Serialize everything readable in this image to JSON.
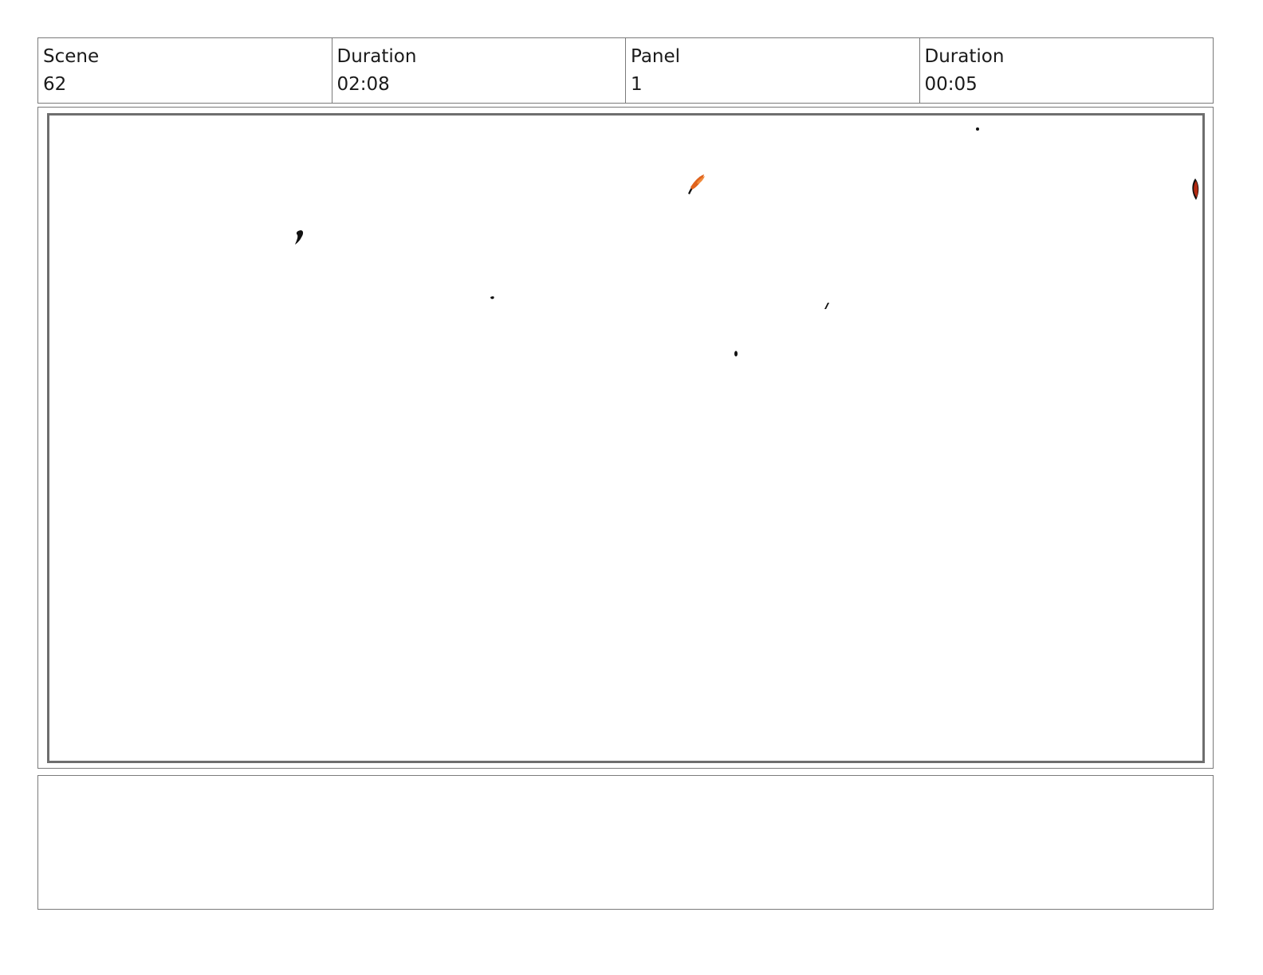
{
  "header": {
    "scene_label": "Scene",
    "scene_value": "62",
    "scene_duration_label": "Duration",
    "scene_duration_value": "02:08",
    "panel_label": "Panel",
    "panel_value": "1",
    "panel_duration_label": "Duration",
    "panel_duration_value": "00:05"
  },
  "colors": {
    "border": "#7a7a7a",
    "ink": "#111111",
    "orange": "#e0631c",
    "red": "#b22a12"
  },
  "notes": {
    "text": ""
  }
}
